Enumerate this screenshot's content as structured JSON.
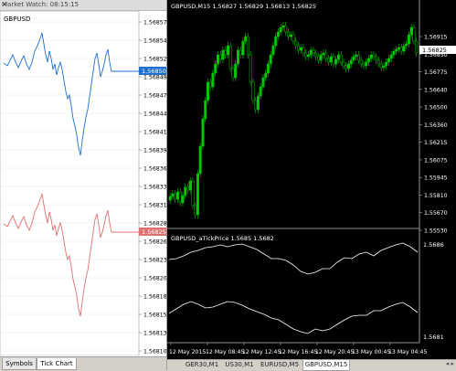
{
  "market_watch": {
    "title": "Market Watch: 08:15:15",
    "close_icon": "close-icon",
    "symbol": "GBPUSD",
    "price_levels": [
      "1.56857",
      "1.56854",
      "1.56852",
      "1.56849",
      "1.56847",
      "1.56844",
      "1.56841",
      "1.56839",
      "1.56836",
      "1.56833",
      "1.56831",
      "1.56828",
      "1.56826",
      "1.56823",
      "1.56820",
      "1.56818",
      "1.56815",
      "1.56813",
      "1.56810"
    ],
    "bid_tag": "1.56850",
    "ask_tag": "1.56825",
    "bid_color": "#1f6fcf",
    "ask_color": "#e07070",
    "tabs": [
      "Symbols",
      "Tick Chart"
    ],
    "active_tab": "Tick Chart"
  },
  "chart_window": {
    "header": "GBPUSD,M15  1.56827 1.56829 1.56813 1.56825",
    "price_levels": [
      "1.56915",
      "1.56850",
      "1.56775",
      "1.56640",
      "1.56500",
      "1.56360",
      "1.56215",
      "1.56075",
      "1.55945",
      "1.55810",
      "1.55670",
      "1.55530"
    ],
    "current_price_tag": "1.56825",
    "candle_color": "#00c800",
    "indicator_header": "GBPUSD_aTickPrice 1.5685 1.5682",
    "indicator_levels": [
      "1.5686",
      "1.5681"
    ],
    "time_labels": [
      "12 May 2015",
      "12 May 08:45",
      "12 May 12:45",
      "12 May 16:45",
      "12 May 20:45",
      "13 May 00:45",
      "13 May 04:45"
    ]
  },
  "bottom_tabs": {
    "items": [
      "GER30,M1",
      "US30,M1",
      "EURUSD,M5",
      "GBPUSD,M15"
    ],
    "active": "GBPUSD,M15",
    "nav_left_icon": "arrow-left-icon",
    "nav_right_icon": "arrow-right-icon"
  }
}
